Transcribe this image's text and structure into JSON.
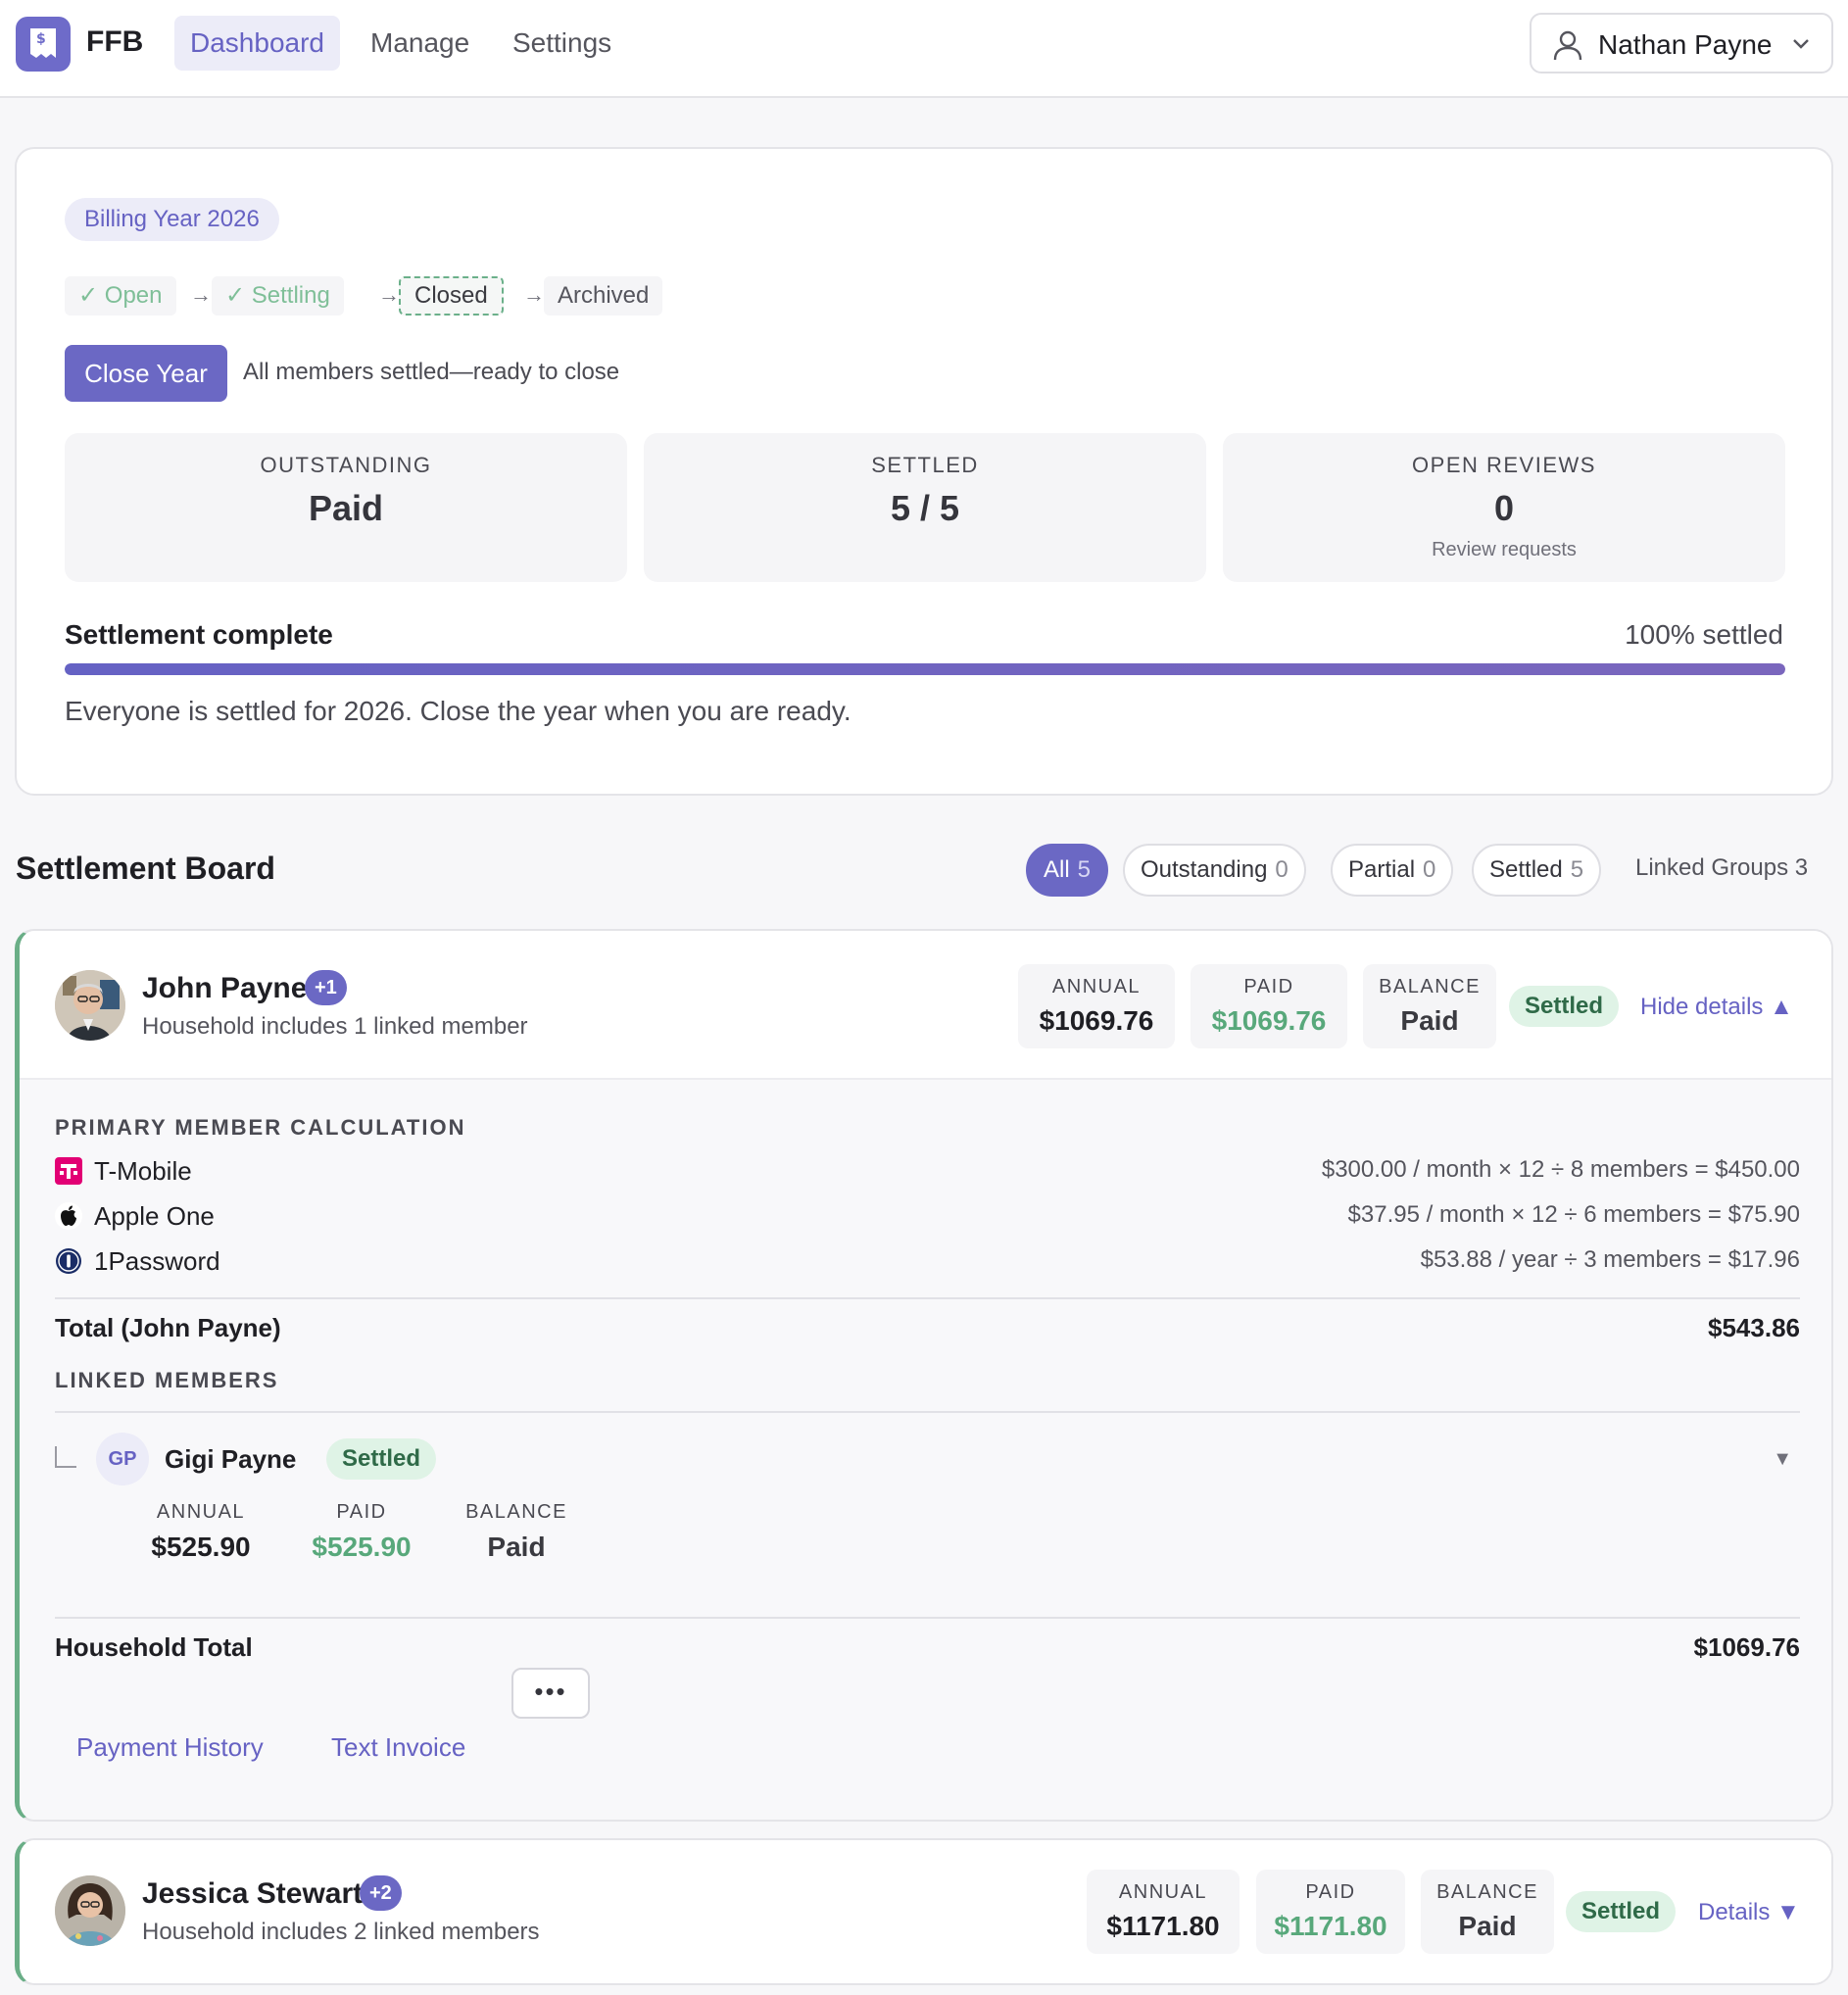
{
  "nav": {
    "brand": "FFB",
    "tabs": [
      {
        "label": "Dashboard",
        "active": true
      },
      {
        "label": "Manage",
        "active": false
      },
      {
        "label": "Settings",
        "active": false
      }
    ],
    "user_name": "Nathan Payne"
  },
  "year": {
    "badge": "Billing Year 2026",
    "stages": [
      {
        "label": "✓ Open",
        "state": "done"
      },
      {
        "label": "✓ Settling",
        "state": "done"
      },
      {
        "label": "Closed",
        "state": "current"
      },
      {
        "label": "Archived",
        "state": "future"
      }
    ],
    "close_button": "Close Year",
    "close_note": "All members settled—ready to close",
    "stats": [
      {
        "label": "OUTSTANDING",
        "value": "Paid",
        "sub": ""
      },
      {
        "label": "SETTLED",
        "value": "5 / 5",
        "sub": ""
      },
      {
        "label": "OPEN REVIEWS",
        "value": "0",
        "sub": "Review requests"
      }
    ],
    "progress_title": "Settlement complete",
    "progress_label": "100% settled",
    "progress_fraction": 1.0,
    "progress_note": "Everyone is settled for 2026. Close the year when you are ready."
  },
  "board": {
    "title": "Settlement Board",
    "filters": [
      {
        "label": "All",
        "count": "5",
        "active": true
      },
      {
        "label": "Outstanding",
        "count": "0",
        "active": false
      },
      {
        "label": "Partial",
        "count": "0",
        "active": false
      },
      {
        "label": "Settled",
        "count": "5",
        "active": false
      }
    ],
    "linked_groups": "Linked Groups 3"
  },
  "members": [
    {
      "name": "John Payne",
      "badge": "+1",
      "subtitle": "Household includes 1 linked member",
      "annual_label": "ANNUAL",
      "annual": "$1069.76",
      "paid_label": "PAID",
      "paid": "$1069.76",
      "balance_label": "BALANCE",
      "balance": "Paid",
      "status": "Settled",
      "toggle": "Hide details ▲",
      "calc_title": "PRIMARY MEMBER CALCULATION",
      "services": [
        {
          "name": "T-Mobile",
          "icon": "t-mobile-icon",
          "calc": "$300.00 / month × 12 ÷ 8 members = $450.00"
        },
        {
          "name": "Apple One",
          "icon": "apple-icon",
          "calc": "$37.95 / month × 12 ÷ 6 members = $75.90"
        },
        {
          "name": "1Password",
          "icon": "1password-icon",
          "calc": "$53.88 / year ÷ 3 members = $17.96"
        }
      ],
      "total_label": "Total (John Payne)",
      "total_value": "$543.86",
      "linked_title": "LINKED MEMBERS",
      "linked": [
        {
          "initials": "GP",
          "name": "Gigi Payne",
          "status": "Settled",
          "caret": "▼",
          "annual_label": "ANNUAL",
          "annual": "$525.90",
          "paid_label": "PAID",
          "paid": "$525.90",
          "balance_label": "BALANCE",
          "balance": "Paid"
        }
      ],
      "household_label": "Household Total",
      "household_value": "$1069.76",
      "actions": [
        "Payment History",
        "Text Invoice"
      ],
      "more": "•••"
    },
    {
      "name": "Jessica Stewart",
      "badge": "+2",
      "subtitle": "Household includes 2 linked members",
      "annual_label": "ANNUAL",
      "annual": "$1171.80",
      "paid_label": "PAID",
      "paid": "$1171.80",
      "balance_label": "BALANCE",
      "balance": "Paid",
      "status": "Settled",
      "toggle": "Details ▼"
    }
  ],
  "colors": {
    "accent": "#6b68c4",
    "success": "#58a87b",
    "success_bg": "#dff3e6",
    "border_success": "#6aae87"
  }
}
